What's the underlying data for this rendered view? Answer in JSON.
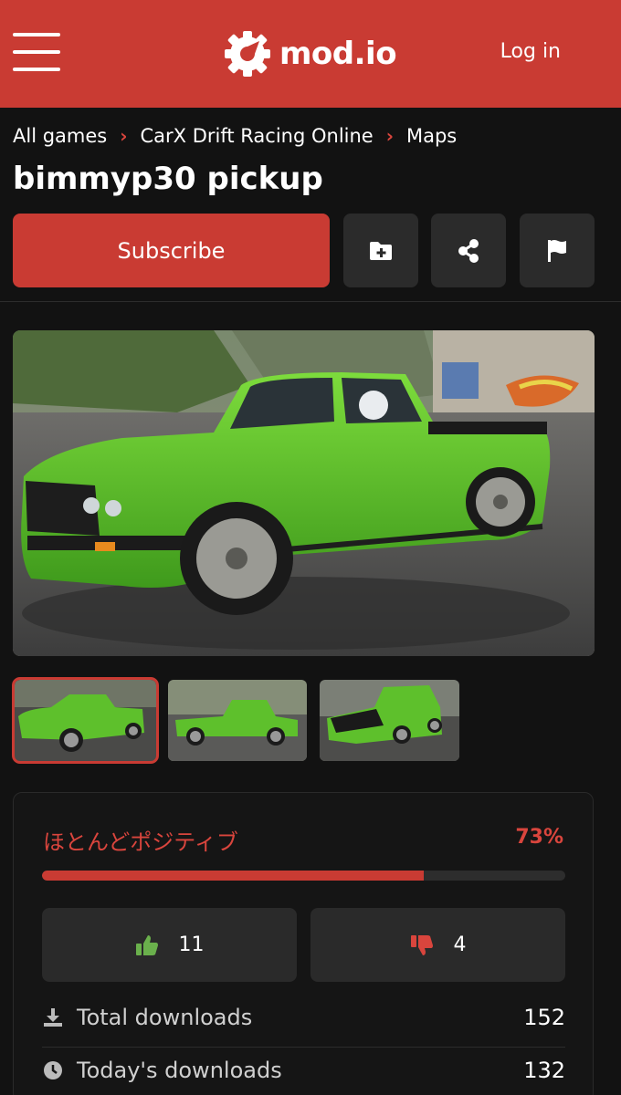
{
  "header": {
    "brand": "mod.io",
    "login_label": "Log in"
  },
  "breadcrumb": [
    "All games",
    "CarX Drift Racing Online",
    "Maps"
  ],
  "mod": {
    "title": "bimmyp30 pickup"
  },
  "actions": {
    "subscribe_label": "Subscribe",
    "icons": [
      "add-to-collection-icon",
      "share-icon",
      "report-flag-icon"
    ]
  },
  "gallery": {
    "thumbnail_count": 3,
    "active_index": 0
  },
  "rating": {
    "label": "ほとんどポジティブ",
    "percent_text": "73%",
    "percent": 73,
    "upvotes": "11",
    "downvotes": "4"
  },
  "stats": [
    {
      "icon": "download-icon",
      "label": "Total downloads",
      "value": "152"
    },
    {
      "icon": "clock-icon",
      "label": "Today's downloads",
      "value": "132"
    }
  ],
  "colors": {
    "brand": "#c93b33",
    "background": "#121212",
    "button": "#2b2b2b",
    "upvote": "#6ab04c",
    "downvote": "#d9453d"
  }
}
